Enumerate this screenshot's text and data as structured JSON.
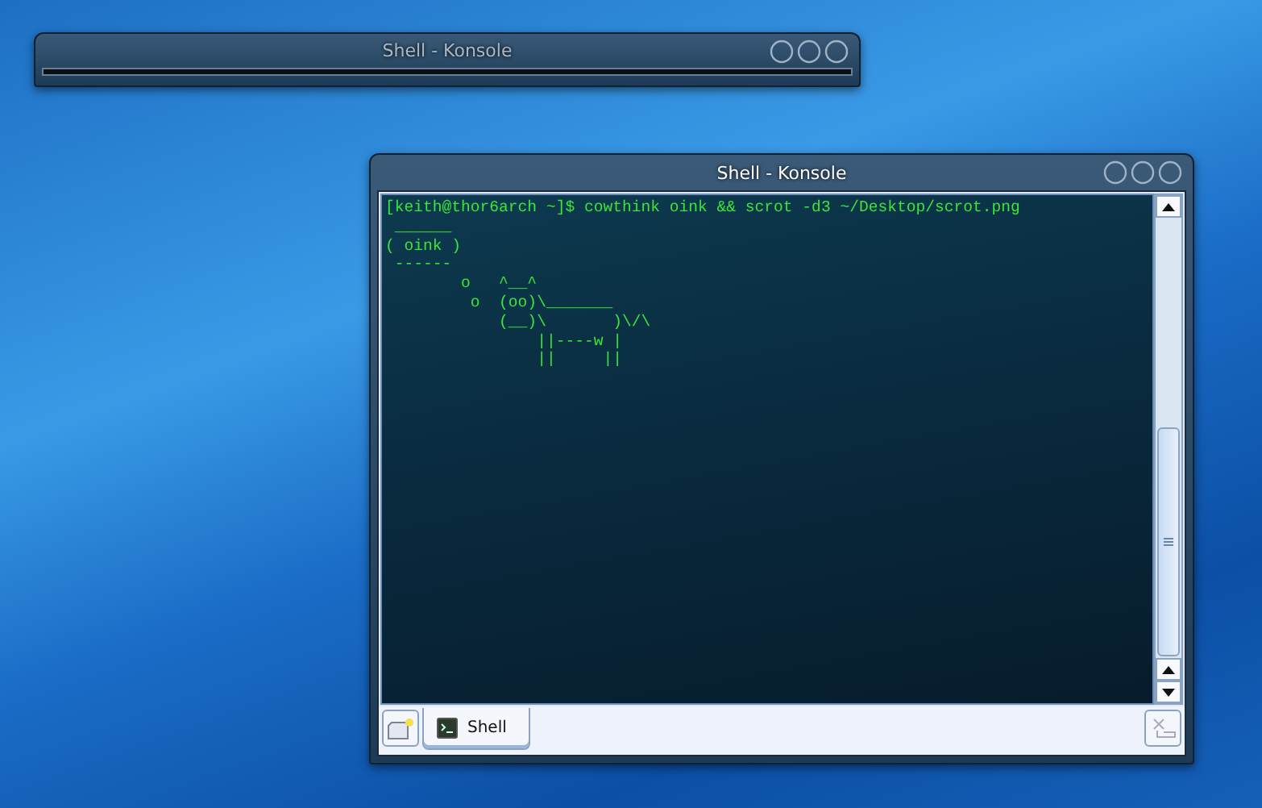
{
  "windows": [
    {
      "kind": "shaded",
      "title": "Shell - Konsole"
    },
    {
      "kind": "terminal",
      "title": "Shell - Konsole",
      "lines": [
        "[keith@thor6arch ~]$ cowthink oink && scrot -d3 ~/Desktop/scrot.png",
        " ______",
        "( oink )",
        " ------",
        "        o   ^__^",
        "         o  (oo)\\_______",
        "            (__)\\       )\\/\\",
        "                ||----w |",
        "                ||     ||"
      ],
      "tabs": [
        {
          "label": "Shell",
          "selected": true
        }
      ]
    }
  ]
}
